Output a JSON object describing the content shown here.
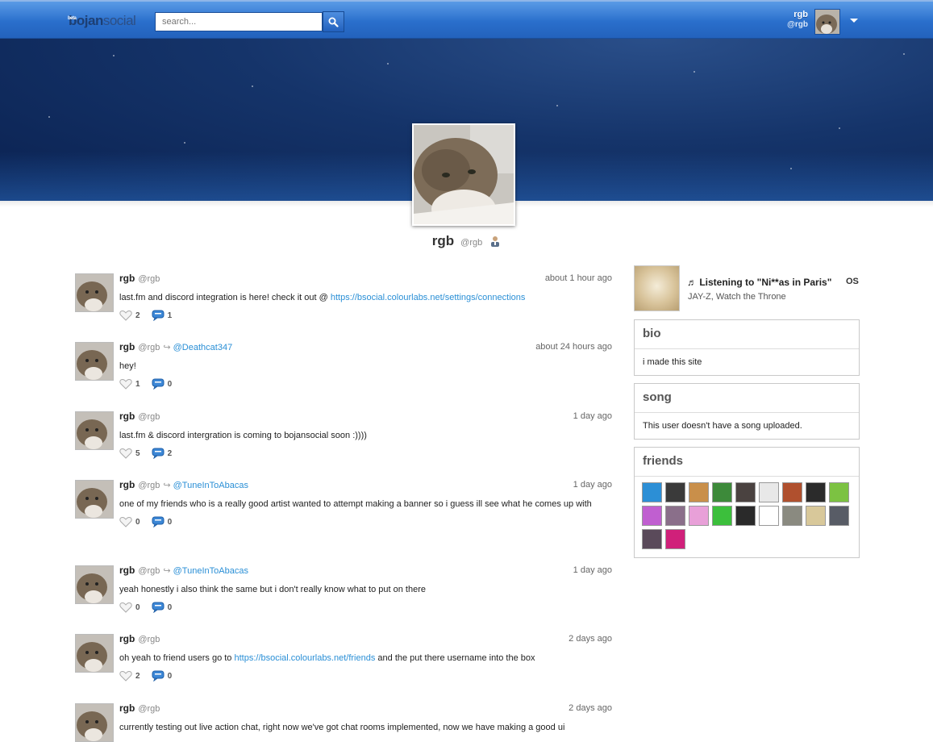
{
  "header": {
    "logo_bold": "bojan",
    "logo_light": "social",
    "logo_beta": "beta",
    "search_placeholder": "search...",
    "user_name": "rgb",
    "user_handle": "@rgb"
  },
  "profile": {
    "name": "rgb",
    "handle": "@rgb"
  },
  "posts": [
    {
      "name": "rgb",
      "handle": "@rgb",
      "reply_to": "",
      "time": "about 1 hour ago",
      "text": "last.fm and discord integration is here! check it out @ ",
      "link": "https://bsocial.colourlabs.net/settings/connections",
      "text_after": "",
      "likes": "2",
      "comments": "1"
    },
    {
      "name": "rgb",
      "handle": "@rgb",
      "reply_to": "@Deathcat347",
      "time": "about 24 hours ago",
      "text": "hey!",
      "link": "",
      "text_after": "",
      "likes": "1",
      "comments": "0"
    },
    {
      "name": "rgb",
      "handle": "@rgb",
      "reply_to": "",
      "time": "1 day ago",
      "text": "last.fm & discord intergration is coming to bojansocial soon :))))",
      "link": "",
      "text_after": "",
      "likes": "5",
      "comments": "2"
    },
    {
      "name": "rgb",
      "handle": "@rgb",
      "reply_to": "@TuneInToAbacas",
      "time": "1 day ago",
      "text": "one of my friends who is a really good artist wanted to attempt making a banner so i guess ill see what he comes up with",
      "link": "",
      "text_after": "",
      "likes": "0",
      "comments": "0"
    },
    {
      "name": "rgb",
      "handle": "@rgb",
      "reply_to": "@TuneInToAbacas",
      "time": "1 day ago",
      "text": "yeah honestly i also think the same but i don't really know what to put on there",
      "link": "",
      "text_after": "",
      "likes": "0",
      "comments": "0"
    },
    {
      "name": "rgb",
      "handle": "@rgb",
      "reply_to": "",
      "time": "2 days ago",
      "text": "oh yeah to friend users go to ",
      "link": "https://bsocial.colourlabs.net/friends",
      "text_after": " and the put there username into the box",
      "likes": "2",
      "comments": "0"
    },
    {
      "name": "rgb",
      "handle": "@rgb",
      "reply_to": "",
      "time": "2 days ago",
      "text": "currently testing out live action chat, right now we've got chat rooms implemented, now we have making a good ui",
      "link": "",
      "text_after": "",
      "likes": "",
      "comments": ""
    }
  ],
  "now_playing": {
    "title": "Listening to \"Ni**as in Paris\"",
    "subtitle": "JAY-Z, Watch the Throne",
    "service_label": "OS"
  },
  "bio": {
    "heading": "bio",
    "text": "i made this site"
  },
  "song": {
    "heading": "song",
    "text": "This user doesn't have a song uploaded."
  },
  "friends": {
    "heading": "friends",
    "colors": [
      "#2c8fd6",
      "#3a3a3a",
      "#c98f4a",
      "#3d8a3a",
      "#4a4240",
      "#e8e8e8",
      "#b0502e",
      "#2b2b2b",
      "#7cc242",
      "#c05fd0",
      "#8a6f8a",
      "#e8a0d8",
      "#3cbf3c",
      "#2a2a2a",
      "#ffffff",
      "#8a8a80",
      "#d8c89a",
      "#585c66",
      "#5a4a5a",
      "#d0207a"
    ]
  },
  "colors": {
    "accent": "#2a6fcc",
    "link": "#2a8fd6"
  }
}
